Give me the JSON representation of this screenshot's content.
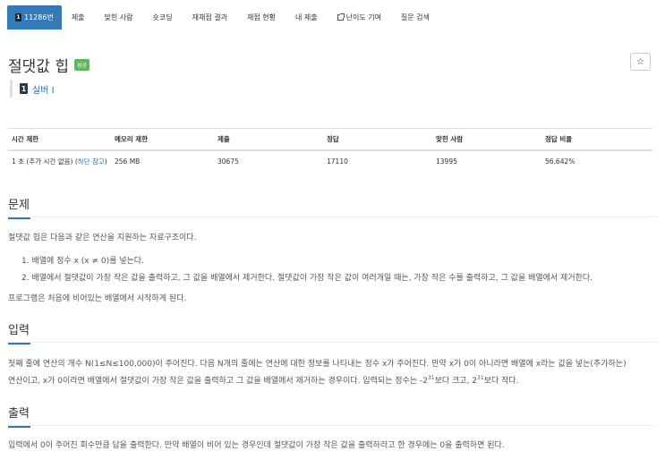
{
  "tabs": [
    {
      "label": "11286번",
      "tier": "1",
      "active": true
    },
    {
      "label": "제출"
    },
    {
      "label": "맞힌 사람"
    },
    {
      "label": "숏코딩"
    },
    {
      "label": "재채점 결과"
    },
    {
      "label": "채점 현황"
    },
    {
      "label": "내 제출"
    },
    {
      "label": "난이도 기여"
    },
    {
      "label": "질문 검색"
    }
  ],
  "problem": {
    "title": "절댓값 힙",
    "badge": "성공",
    "star": "☆",
    "tier_icon": "1",
    "tier_label": "실버 I"
  },
  "info_table": {
    "headers": [
      "시간 제한",
      "메모리 제한",
      "제출",
      "정답",
      "맞힌 사람",
      "정답 비율"
    ],
    "time_limit": "1 초 (추가 시간 없음) (",
    "time_link": "하단 참고",
    "time_close": ")",
    "memory": "256 MB",
    "submissions": "30675",
    "correct": "17110",
    "solvers": "13995",
    "ratio": "56.642%"
  },
  "sections": {
    "problem_title": "문제",
    "problem_intro": "절댓값 힙은 다음과 같은 연산을 지원하는 자료구조이다.",
    "problem_items": [
      "1. 배열에 정수 x (x ≠ 0)를 넣는다.",
      "2. 배열에서 절댓값이 가장 작은 값을 출력하고, 그 값을 배열에서 제거한다. 절댓값이 가장 작은 값이 여러개일 때는, 가장 작은 수를 출력하고, 그 값을 배열에서 제거한다."
    ],
    "problem_outro": "프로그램은 처음에 비어있는 배열에서 시작하게 된다.",
    "input_title": "입력",
    "input_line1": "첫째 줄에 연산의 개수 N(1≤N≤100,000)이 주어진다. 다음 N개의 줄에는 연산에 대한 정보를 나타내는 정수 x가 주어진다. 만약 x가 0이 아니라면 배열에 x라는 값을 넣는(추가하는)",
    "input_line2_a": "연산이고, x가 0이라면 배열에서 절댓값이 가장 작은 값을 출력하고 그 값을 배열에서 제거하는 경우이다. 입력되는 정수는 -2",
    "input_exp1": "31",
    "input_line2_b": "보다 크고, 2",
    "input_exp2": "31",
    "input_line2_c": "보다 작다.",
    "output_title": "출력",
    "output_text": "입력에서 0이 주어진 회수만큼 답을 출력한다. 만약 배열이 비어 있는 경우인데 절댓값이 가장 작은 값을 출력하라고 한 경우에는 0을 출력하면 된다."
  }
}
